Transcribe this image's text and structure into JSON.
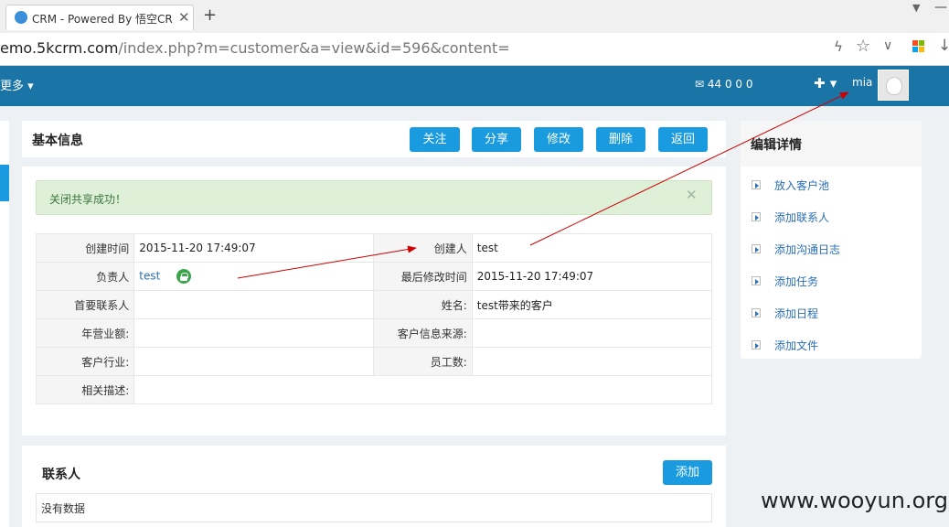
{
  "browser": {
    "tab_title": "CRM - Powered By 悟空CR",
    "url_host": "emo.5kcrm.com",
    "url_path": "/index.php?m=customer&a=view&id=596&content="
  },
  "topnav": {
    "more_label": "更多",
    "counters": "44  0  0  0",
    "username": "mia"
  },
  "main": {
    "title": "基本信息",
    "buttons": [
      "关注",
      "分享",
      "修改",
      "删除",
      "返回"
    ],
    "alert": "关闭共享成功！",
    "fields": {
      "created_time_label": "创建时间",
      "created_time": "2015-11-20 17:49:07",
      "creator_label": "创建人",
      "creator": "test",
      "owner_label": "负责人",
      "owner": "test",
      "modified_time_label": "最后修改时间",
      "modified_time": "2015-11-20 17:49:07",
      "primary_contact_label": "首要联系人",
      "primary_contact": "",
      "name_label": "姓名:",
      "name": "test带来的客户",
      "revenue_label": "年营业额:",
      "revenue": "",
      "source_label": "客户信息来源:",
      "source": "",
      "industry_label": "客户行业:",
      "industry": "",
      "employees_label": "员工数:",
      "employees": "",
      "description_label": "相关描述:",
      "description": ""
    }
  },
  "contacts": {
    "title": "联系人",
    "add_label": "添加",
    "empty_text": "没有数据"
  },
  "sidebar": {
    "title": "编辑详情",
    "items": [
      "放入客户池",
      "添加联系人",
      "添加沟通日志",
      "添加任务",
      "添加日程",
      "添加文件"
    ]
  },
  "watermark": "www.wooyun.org",
  "colors": {
    "nav_bg": "#1a74a6",
    "button_bg": "#1a9be0",
    "link": "#2a6eb5",
    "annotation_arrow": "#cc0000"
  }
}
